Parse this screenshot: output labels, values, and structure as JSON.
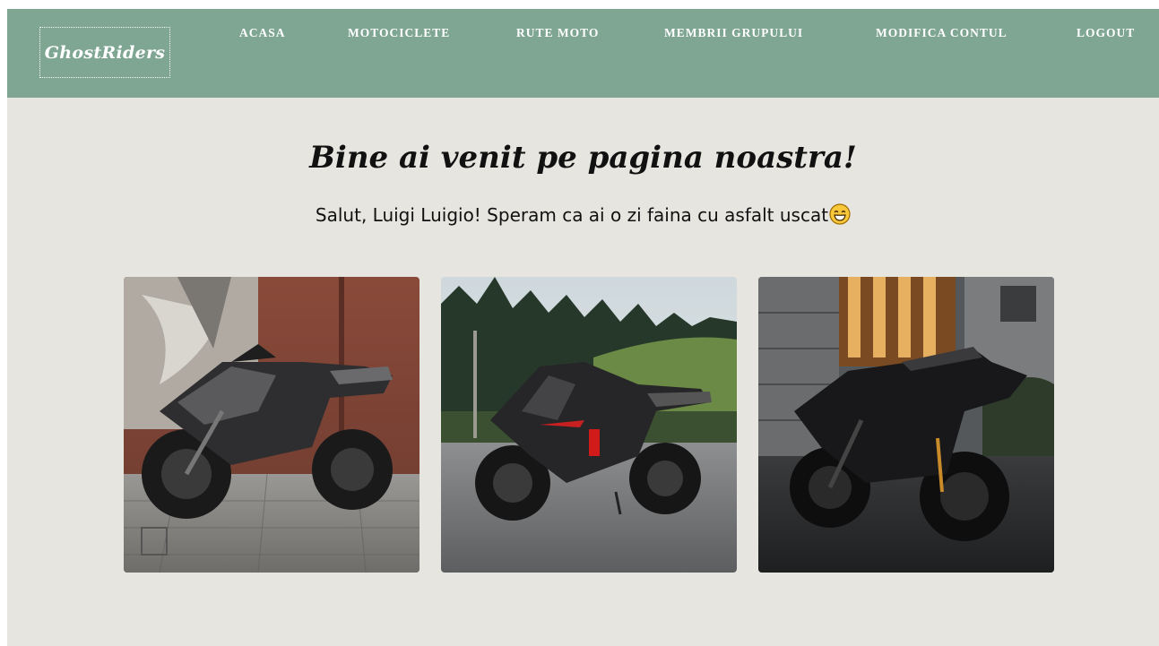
{
  "nav": {
    "logo": "GhostRiders",
    "items": [
      {
        "label": "ACASA"
      },
      {
        "label": "MOTOCICLETE"
      },
      {
        "label": "RUTE MOTO"
      },
      {
        "label": "MEMBRII GRUPULUI"
      },
      {
        "label": "MODIFICA CONTUL"
      },
      {
        "label": "LOGOUT"
      }
    ]
  },
  "main": {
    "headline": "Bine ai venit pe pagina noastra!",
    "greeting": "Salut, Luigi Luigio! Speram ca ai o zi faina cu asfalt uscat",
    "greeting_emoji": "grinning-face-emoji"
  },
  "gallery": {
    "images": [
      {
        "subject": "motorcycle-photo-kawasaki"
      },
      {
        "subject": "motorcycle-photo-honda"
      },
      {
        "subject": "motorcycle-photo-yamaha"
      }
    ]
  },
  "colors": {
    "navbar": "#7fa593",
    "background": "#e6e5df",
    "text": "#111111"
  }
}
